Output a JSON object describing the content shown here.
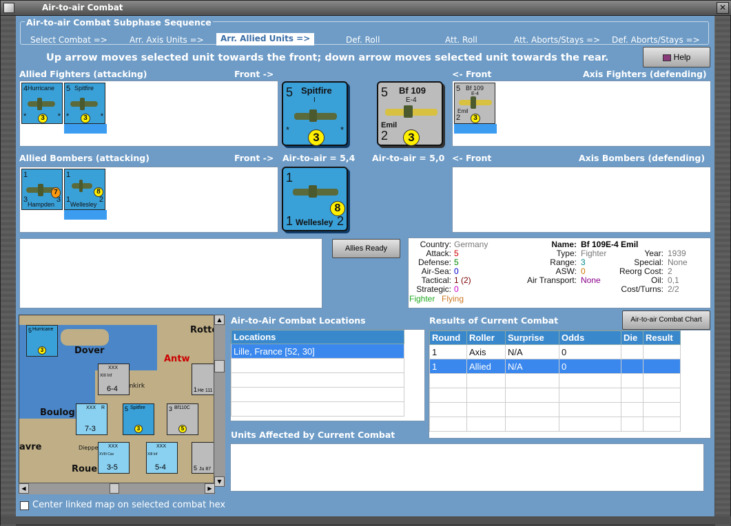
{
  "window": {
    "title": "Air-to-air Combat",
    "close_glyph": "✕"
  },
  "sequence": {
    "title": "Air-to-air Combat Subphase Sequence",
    "steps": [
      {
        "label": "Select Combat =>"
      },
      {
        "label": "Arr. Axis Units =>"
      },
      {
        "label": "Arr. Allied Units =>"
      },
      {
        "label": "Def. Roll"
      },
      {
        "label": "Att. Roll"
      },
      {
        "label": "Att. Aborts/Stays =>"
      },
      {
        "label": "Def. Aborts/Stays =>"
      }
    ]
  },
  "instructions": "Up arrow moves selected unit towards the front; down arrow moves selected unit towards the rear.",
  "help_button": "Help",
  "labels": {
    "allied_fighters": "Allied Fighters (attacking)",
    "front_right": "Front ->",
    "front_left": "<- Front",
    "axis_fighters": "Axis Fighters (defending)",
    "allied_bombers": "Allied Bombers (attacking)",
    "axis_bombers": "Axis Bombers (defending)",
    "air_to_air_allied": "Air-to-air = 5,4",
    "air_to_air_axis": "Air-to-air = 5,0",
    "combat_locations": "Air-to-Air Combat Locations",
    "results": "Results of Current Combat",
    "units_affected": "Units Affected by Current Combat",
    "center_map": "Center linked map on selected combat hex"
  },
  "buttons": {
    "allies_ready": "Allies Ready",
    "combat_chart": "Air-to-air Combat Chart"
  },
  "allied_fighters": [
    {
      "name": "Hurricane",
      "sub": "I",
      "top": "4",
      "bottom_left": "*",
      "bottom_right": "*",
      "value": "3"
    },
    {
      "name": "Spitfire",
      "sub": "I",
      "top": "5",
      "bottom_left": "*",
      "bottom_right": "*",
      "value": "3"
    }
  ],
  "allied_bombers": [
    {
      "name": "Hampden",
      "top": "1",
      "bottom_left": "3",
      "bottom_right": "3",
      "value": "7"
    },
    {
      "name": "Wellesley",
      "top": "1",
      "bottom_left": "1",
      "bottom_right": "2",
      "value": "8"
    }
  ],
  "axis_fighters": [
    {
      "name": "Bf 109",
      "sub": "E-4",
      "extra": "Emil",
      "top": "5",
      "bottom_left": "2",
      "value": "3"
    }
  ],
  "selected_allied_fighter": {
    "name": "Spitfire",
    "sub": "I",
    "top": "5",
    "bottom_left": "*",
    "bottom_right": "*",
    "value": "3"
  },
  "selected_axis_fighter": {
    "name": "Bf 109",
    "sub": "E-4",
    "extra": "Emil",
    "top": "5",
    "bottom_left": "2",
    "value": "3"
  },
  "selected_allied_bomber": {
    "name": "Wellesley",
    "top": "1",
    "bottom_left": "1",
    "bottom_right": "2",
    "value": "8"
  },
  "unit_info": {
    "country_label": "Country:",
    "country": "Germany",
    "attack_label": "Attack:",
    "attack": "5",
    "defense_label": "Defense:",
    "defense": "5",
    "air_sea_label": "Air-Sea:",
    "air_sea": "0",
    "tactical_label": "Tactical:",
    "tactical": "1 (2)",
    "strategic_label": "Strategic:",
    "strategic": "0",
    "fighter": "Fighter",
    "flying": "Flying",
    "name_label": "Name:",
    "name": "Bf 109E-4 Emil",
    "type_label": "Type:",
    "type": "Fighter",
    "range_label": "Range:",
    "range": "3",
    "asw_label": "ASW:",
    "asw": "0",
    "air_transport_label": "Air Transport:",
    "air_transport": "None",
    "year_label": "Year:",
    "year": "1939",
    "special_label": "Special:",
    "special": "None",
    "reorg_label": "Reorg Cost:",
    "reorg": "2",
    "oil_label": "Oil:",
    "oil": "0,1",
    "cost_label": "Cost/Turns:",
    "cost": "2/2"
  },
  "locations": {
    "header": "Locations",
    "rows": [
      {
        "text": "Lille, France [52, 30]"
      },
      {
        "text": ""
      },
      {
        "text": ""
      },
      {
        "text": ""
      },
      {
        "text": ""
      }
    ]
  },
  "results": {
    "headers": [
      "Round",
      "Roller",
      "Surprise",
      "Odds",
      "Die",
      "Result"
    ],
    "rows": [
      [
        "1",
        "Axis",
        "N/A",
        "0",
        "",
        ""
      ],
      [
        "1",
        "Allied",
        "N/A",
        "0",
        "",
        ""
      ],
      [
        "",
        "",
        "",
        "",
        "",
        ""
      ],
      [
        "",
        "",
        "",
        "",
        "",
        ""
      ],
      [
        "",
        "",
        "",
        "",
        "",
        ""
      ],
      [
        "",
        "",
        "",
        "",
        "",
        ""
      ]
    ]
  },
  "map": {
    "labels": {
      "dover": "Dover",
      "rotterdam": "Rotterd",
      "boulogne": "Boulog",
      "antwerp": "Antw",
      "dunkirk": "unkirk",
      "havre": "avre",
      "rouen": "Roue",
      "dieppe": "Dieppe"
    },
    "counters": [
      {
        "top": "5",
        "name": "Hurricane",
        "value": "3"
      },
      {
        "type": "XXX",
        "sub": "XIII Inf",
        "value": "6-4"
      },
      {
        "type": "XXX",
        "sub": "R",
        "value": "7-3"
      },
      {
        "top": "5",
        "name": "Spitfire",
        "value": "3"
      },
      {
        "top": "3",
        "name": "Bf110C",
        "value": "5"
      },
      {
        "type": "XXX",
        "sub": "XVIII Cav",
        "value": "3-5"
      },
      {
        "type": "XXX",
        "sub": "XIII Inf",
        "value": "5-4"
      },
      {
        "name": "He 111",
        "value": "1"
      },
      {
        "name": "Ju 87",
        "value": "5"
      }
    ]
  }
}
